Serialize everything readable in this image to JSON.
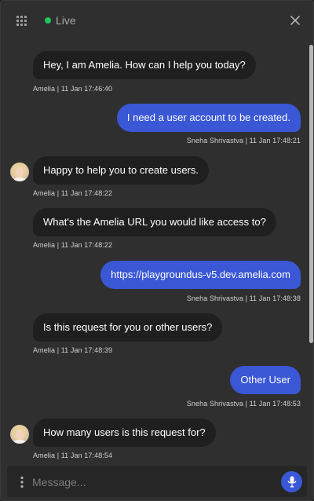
{
  "header": {
    "status_label": "Live",
    "status_color": "#22c55e",
    "menu_icon": "grid-icon",
    "close_icon": "close-icon"
  },
  "messages": [
    {
      "sender": "agent",
      "text": "Hey, I am Amelia. How can I help you today?",
      "meta": "Amelia | 11 Jan 17:46:40"
    },
    {
      "sender": "user",
      "text": "I need a user account to be created.",
      "meta": "Sneha Shrivastva | 11 Jan 17:48:21"
    },
    {
      "sender": "agent",
      "text": "Happy to help you to create users.",
      "meta": "Amelia | 11 Jan 17:48:22"
    },
    {
      "sender": "agent",
      "text": "What's the Amelia URL you would like access to?",
      "meta": "Amelia | 11 Jan 17:48:22"
    },
    {
      "sender": "user",
      "text": "https://playgroundus-v5.dev.amelia.com",
      "meta": "Sneha Shrivastva | 11 Jan 17:48:38"
    },
    {
      "sender": "agent",
      "text": "Is this request for you or other users?",
      "meta": "Amelia | 11 Jan 17:48:39"
    },
    {
      "sender": "user",
      "text": "Other User",
      "meta": "Sneha Shrivastva | 11 Jan 17:48:53"
    },
    {
      "sender": "agent",
      "text": "How many users is this request for?",
      "meta": "Amelia | 11 Jan 17:48:54"
    }
  ],
  "composer": {
    "placeholder": "Message...",
    "more_icon": "more-vertical-icon",
    "mic_icon": "microphone-icon"
  },
  "colors": {
    "user_bubble": "#3a57d6",
    "agent_bubble": "#1f1f1f",
    "panel_background": "#2f2f2f"
  }
}
